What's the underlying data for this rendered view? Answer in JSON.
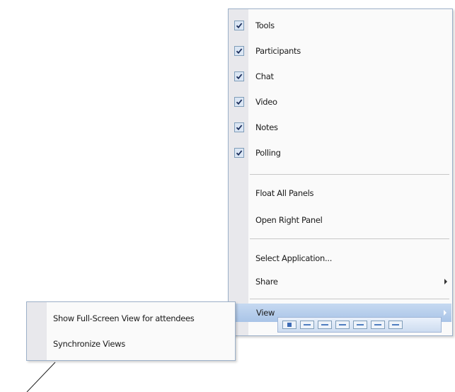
{
  "view_menu": {
    "items": [
      {
        "label": "Tools",
        "checked": true
      },
      {
        "label": "Participants",
        "checked": true
      },
      {
        "label": "Chat",
        "checked": true
      },
      {
        "label": "Video",
        "checked": true
      },
      {
        "label": "Notes",
        "checked": true
      },
      {
        "label": "Polling",
        "checked": true
      },
      {
        "label": "Float All Panels",
        "checked": false
      },
      {
        "label": "Open Right Panel",
        "checked": false
      },
      {
        "label": "Select Application...",
        "checked": false
      },
      {
        "label": "Share",
        "checked": false,
        "submenu": true
      },
      {
        "label": "View",
        "checked": false,
        "submenu": true,
        "highlighted": true
      }
    ]
  },
  "view_submenu": {
    "items": [
      {
        "label": "Show Full-Screen View for attendees"
      },
      {
        "label": "Synchronize Views"
      }
    ]
  },
  "toolbar": {
    "icons": [
      "arrow-icon",
      "lines-icon",
      "lines-icon",
      "lines-icon",
      "lines-icon",
      "lines-icon",
      "lines-icon"
    ]
  },
  "colors": {
    "highlight": "#b3cbea",
    "check_bg": "#dbe6f4",
    "border": "#9cb0c8"
  }
}
